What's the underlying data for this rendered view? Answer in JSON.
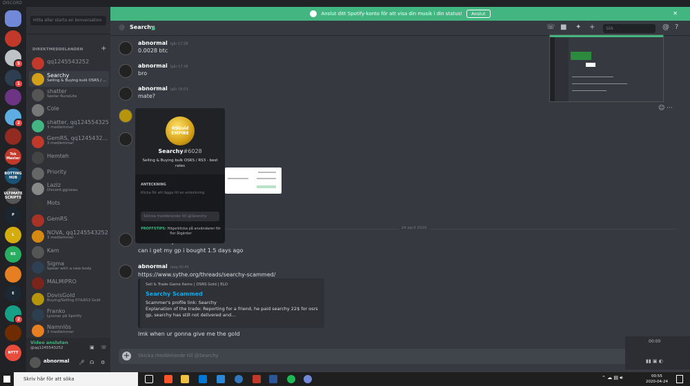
{
  "window": {
    "title": "DISCORD"
  },
  "guilds": [
    {
      "icon": "discord-home-icon",
      "color": "#7289da",
      "label": "",
      "badge": ""
    },
    {
      "icon": "server-icon",
      "color": "#c0392b",
      "label": "",
      "badge": ""
    },
    {
      "icon": "server-icon",
      "color": "#bdc3c7",
      "label": "",
      "badge": "5"
    },
    {
      "icon": "server-icon",
      "color": "#2c3e50",
      "label": "",
      "badge": "1"
    },
    {
      "icon": "server-icon",
      "color": "#6c3483",
      "label": "",
      "badge": ""
    },
    {
      "icon": "server-icon",
      "color": "#5dade2",
      "label": "",
      "badge": "2"
    },
    {
      "icon": "server-icon",
      "color": "#922b21",
      "label": "",
      "badge": ""
    },
    {
      "icon": "server-icon",
      "color": "#c0392b",
      "label": "Tok Master",
      "badge": ""
    },
    {
      "icon": "server-icon",
      "color": "#1a5276",
      "label": "BOTTING HUB",
      "badge": ""
    },
    {
      "icon": "server-icon",
      "color": "#555555",
      "label": "ULTIMATE SCRIPTS",
      "badge": ""
    },
    {
      "icon": "server-icon",
      "color": "#1b2631",
      "label": "P",
      "badge": ""
    },
    {
      "icon": "server-icon",
      "color": "#d4ac0d",
      "label": "L",
      "badge": ""
    },
    {
      "icon": "server-icon",
      "color": "#27ae60",
      "label": "RS",
      "badge": ""
    },
    {
      "icon": "server-icon",
      "color": "#e67e22",
      "label": "",
      "badge": ""
    },
    {
      "icon": "server-icon",
      "color": "#1c2833",
      "label": "E",
      "badge": ""
    },
    {
      "icon": "server-icon",
      "color": "#16a085",
      "label": "",
      "badge": "2"
    },
    {
      "icon": "server-icon",
      "color": "#6e2c00",
      "label": "",
      "badge": ""
    },
    {
      "icon": "server-icon",
      "color": "#e74c3c",
      "label": "NYTT",
      "badge": ""
    }
  ],
  "sidebar": {
    "search_placeholder": "Hitta eller starta en konversation",
    "dm_header": "DIREKTMEDDELANDEN",
    "dms": [
      {
        "name": "qq1245543252",
        "sub": "",
        "color": "#c0392b"
      },
      {
        "name": "Searchy",
        "sub": "Selling & Buying bulk OSRS / ...",
        "color": "#d4a017",
        "active": true
      },
      {
        "name": "shatter",
        "sub": "Spelar RuneLite",
        "color": "#555555"
      },
      {
        "name": "Cole",
        "sub": "",
        "color": "#777777"
      },
      {
        "name": "shatter, qq1245543252",
        "sub": "3 medlemmar",
        "color": "#43b581"
      },
      {
        "name": "GemRS, qq1245432...",
        "sub": "3 medlemmar",
        "color": "#c0392b"
      },
      {
        "name": "Hemteh",
        "sub": "",
        "color": "#444444"
      },
      {
        "name": "Priority",
        "sub": "",
        "color": "#666666"
      },
      {
        "name": "Laziz",
        "sub": "Discord.gg/xeau",
        "color": "#888888"
      },
      {
        "name": "Mots",
        "sub": "",
        "color": "#333333"
      },
      {
        "name": "GemRS",
        "sub": "",
        "color": "#a93226"
      },
      {
        "name": "NOVA, qq1245543252",
        "sub": "3 medlemmar",
        "color": "#d68910"
      },
      {
        "name": "Kam",
        "sub": "",
        "color": "#555555"
      },
      {
        "name": "Sigma",
        "sub": "Spelar with a new body",
        "color": "#2e4053"
      },
      {
        "name": "MALMIPRO",
        "sub": "",
        "color": "#7b241c"
      },
      {
        "name": "DovisGold",
        "sub": "Buying/Selling 07&RS3 Gold",
        "color": "#b7950b"
      },
      {
        "name": "Franko",
        "sub": "Lyssnar på Spotify",
        "color": "#2c3e50"
      },
      {
        "name": "Namnlös",
        "sub": "3 medlemmar",
        "color": "#e67e22"
      }
    ],
    "voice_status": "Video ansluten",
    "voice_channel": "@qq1245543252",
    "username": "abnormal"
  },
  "banner": {
    "text": "Anslut ditt Spotify-konto för att visa din musik i din status!",
    "button": "Anslut"
  },
  "channel": {
    "name": "Searchy",
    "search_placeholder": "Sök"
  },
  "messages": [
    {
      "author": "abnormal",
      "time": "Igår 17:38",
      "text": "0.0028 btc"
    },
    {
      "author": "abnormal",
      "time": "Igår 17:38",
      "text": "bro"
    },
    {
      "author": "abnormal",
      "time": "Igår 18:03",
      "text": "mate?"
    }
  ],
  "popout": {
    "logo_line1": "RSGold",
    "logo_line2": "EMPIRE",
    "name": "Searchy",
    "tag": "#6028",
    "bio": "Selling & Buying bulk OSRS / RS3 - best rates",
    "note_label": "ANTECKNING",
    "note_placeholder": "Klicka för att lägga till en anteckning",
    "message_placeholder": "Skicka meddelande till @Searchy",
    "tip_label": "PROFFSTIPS:",
    "tip_text": "Högerklicka på användaren för fler åtgärder"
  },
  "date_divider": "24 april 2020",
  "later": {
    "partial": "hello searchy",
    "line2": "can i get my gp i bought 1.5 days ago",
    "author": "abnormal",
    "time": "Idag 00:45",
    "link": "https://www.sythe.org/threads/searchy-scammed/",
    "embed_site": "Sell & Trade Game Items | OSRS Gold | ELO",
    "embed_title": "Searchy Scammed",
    "embed_desc1": "Scammer's profile link: Searchy",
    "embed_desc2": "Explanation of the trade: Reporting for a friend, he paid searchy 22$ for osrs gp, searchy has still not delivered and...",
    "last": "lmk when ur gonna give me the gold"
  },
  "composer": {
    "placeholder": "Skicka meddelande till @Searchy"
  },
  "media": {
    "time": "00:00"
  },
  "taskbar": {
    "search": "Skriv här för att söka",
    "time": "00:55",
    "date": "2020-04-24"
  }
}
